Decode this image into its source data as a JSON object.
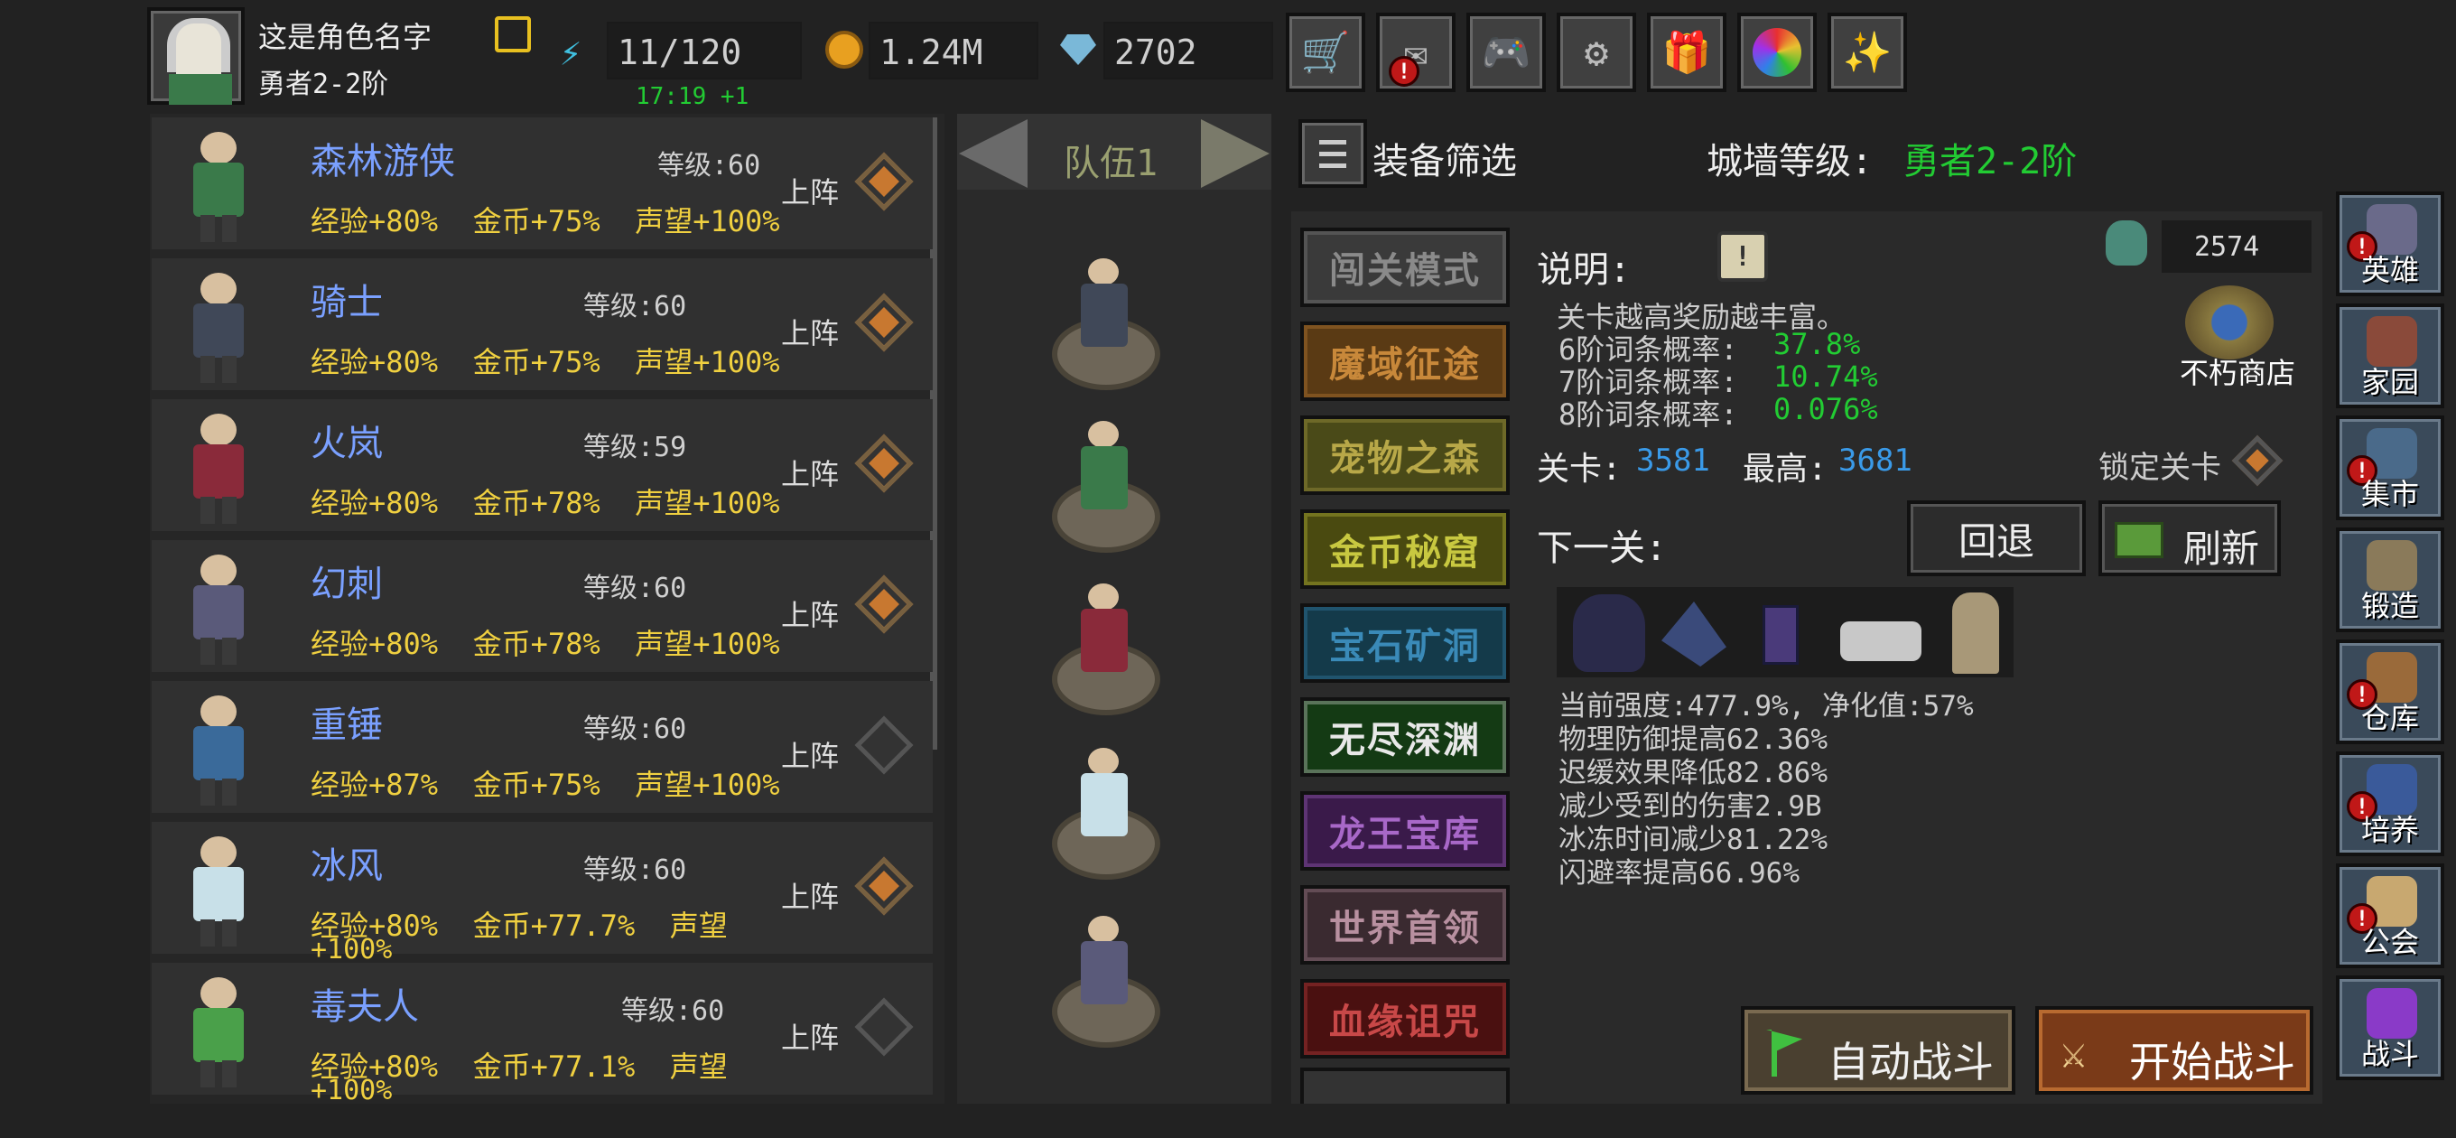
{
  "player": {
    "name": "这是角色名字",
    "rank": "勇者2-2阶",
    "edit_icon": "pencil-edit-icon"
  },
  "resources": {
    "energy": "11/120",
    "energy_timer": "17:19 +1",
    "gold": "1.24M",
    "gems": "2702"
  },
  "top_buttons": [
    "cart-icon",
    "mail-icon",
    "gamepad-icon",
    "gear-icon",
    "gift-icon",
    "color-wheel-icon",
    "fireworks-icon"
  ],
  "hero_list": [
    {
      "name": "森林游侠",
      "level": "等级:60",
      "exp": "经验+80%",
      "gold": "金币+75%",
      "fame": "声望+100%",
      "fame2": "",
      "deploy": "上阵",
      "deployed": true,
      "color": "#3a7a4a"
    },
    {
      "name": "骑士",
      "level": "等级:60",
      "exp": "经验+80%",
      "gold": "金币+75%",
      "fame": "声望+100%",
      "fame2": "",
      "deploy": "上阵",
      "deployed": true,
      "color": "#404858"
    },
    {
      "name": "火岚",
      "level": "等级:59",
      "exp": "经验+80%",
      "gold": "金币+78%",
      "fame": "声望+100%",
      "fame2": "",
      "deploy": "上阵",
      "deployed": true,
      "color": "#8a2a3a"
    },
    {
      "name": "幻刺",
      "level": "等级:60",
      "exp": "经验+80%",
      "gold": "金币+78%",
      "fame": "声望+100%",
      "fame2": "",
      "deploy": "上阵",
      "deployed": true,
      "color": "#5a5a7a"
    },
    {
      "name": "重锤",
      "level": "等级:60",
      "exp": "经验+87%",
      "gold": "金币+75%",
      "fame": "声望+100%",
      "fame2": "",
      "deploy": "上阵",
      "deployed": false,
      "color": "#3a6a9a"
    },
    {
      "name": "冰风",
      "level": "等级:60",
      "exp": "经验+80%",
      "gold": "金币+77.7%",
      "fame": "声望",
      "fame2": "+100%",
      "deploy": "上阵",
      "deployed": true,
      "color": "#c8e0e8"
    },
    {
      "name": "毒夫人",
      "level": "等级:60",
      "exp": "经验+80%",
      "gold": "金币+77.1%",
      "fame": "声望",
      "fame2": "+100%",
      "deploy": "上阵",
      "deployed": false,
      "color": "#4aa04a"
    }
  ],
  "team": {
    "label": "队伍1"
  },
  "filter": {
    "label": "装备筛选"
  },
  "wall": {
    "label": "城墙等级:",
    "value": "勇者2-2阶"
  },
  "dungeons": [
    {
      "label": "闯关模式",
      "bg": "#3a3a3a",
      "fg": "#8a8a8a"
    },
    {
      "label": "魔域征途",
      "bg": "#5a3a14",
      "fg": "#c8883a"
    },
    {
      "label": "宠物之森",
      "bg": "#4a4a18",
      "fg": "#b8a848"
    },
    {
      "label": "金币秘窟",
      "bg": "#4a4a10",
      "fg": "#c8c840"
    },
    {
      "label": "宝石矿洞",
      "bg": "#143a4a",
      "fg": "#3a8ab8"
    },
    {
      "label": "无尽深渊",
      "bg": "#143a14",
      "fg": "#e8e8e8"
    },
    {
      "label": "龙王宝库",
      "bg": "#3a1a4a",
      "fg": "#a868c8"
    },
    {
      "label": "世界首领",
      "bg": "#3a2a30",
      "fg": "#b890a0"
    },
    {
      "label": "血缘诅咒",
      "bg": "#4a1010",
      "fg": "#c84848"
    }
  ],
  "info": {
    "title": "说明:",
    "currency": "2574",
    "shop": "不朽商店",
    "desc": "关卡越高奖励越丰富。",
    "rates": [
      {
        "label": "6阶词条概率:",
        "value": "37.8%"
      },
      {
        "label": "7阶词条概率:",
        "value": "10.74%"
      },
      {
        "label": "8阶词条概率:",
        "value": "0.076%"
      }
    ],
    "stage_label": "关卡:",
    "stage": "3581",
    "best_label": "最高:",
    "best": "3681",
    "lock_label": "锁定关卡",
    "next_label": "下一关:",
    "back_btn": "回退",
    "refresh_btn": "刷新",
    "stats": [
      "当前强度:477.9%, 净化值:57%",
      "物理防御提高62.36%",
      "迟缓效果降低82.86%",
      "减少受到的伤害2.9B",
      "冰冻时间减少81.22%",
      "闪避率提高66.96%"
    ]
  },
  "actions": {
    "auto": "自动战斗",
    "start": "开始战斗"
  },
  "right_nav": [
    {
      "label": "英雄",
      "badge": true,
      "color": "#6a6a8a"
    },
    {
      "label": "家园",
      "badge": false,
      "color": "#8a4a3a"
    },
    {
      "label": "集市",
      "badge": true,
      "color": "#4a6a8a"
    },
    {
      "label": "锻造",
      "badge": false,
      "color": "#8a7a5a"
    },
    {
      "label": "仓库",
      "badge": true,
      "color": "#9a6a3a"
    },
    {
      "label": "培养",
      "badge": true,
      "color": "#3a5a9a"
    },
    {
      "label": "公会",
      "badge": true,
      "color": "#c8a870"
    },
    {
      "label": "战斗",
      "badge": false,
      "color": "#8a3ac8"
    }
  ],
  "colors": {
    "green": "#22cc33",
    "blue": "#3a9ae8",
    "gold": "#f0d040",
    "hero_name": "#7aa0ff"
  }
}
